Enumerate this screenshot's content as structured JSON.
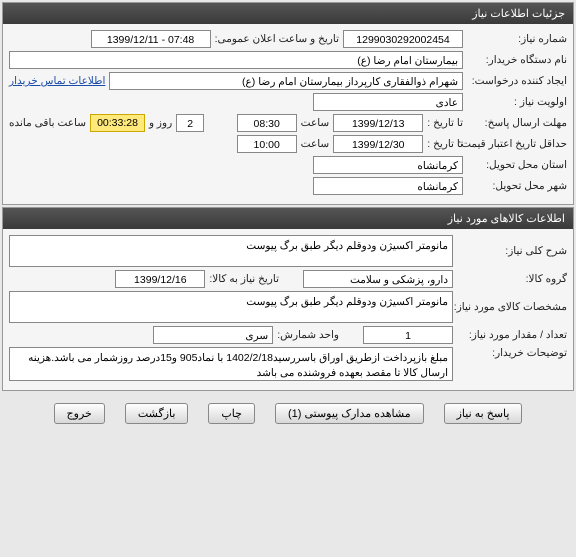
{
  "panel1": {
    "title": "جزئیات اطلاعات نیاز",
    "need_no_label": "شماره نیاز:",
    "need_no": "1299030292002454",
    "pub_datetime_label": "تاریخ و ساعت اعلان عمومی:",
    "pub_datetime": "1399/12/11 - 07:48",
    "buyer_org_label": "نام دستگاه خریدار:",
    "buyer_org": "بیمارستان امام رضا (ع)",
    "requester_label": "ایجاد کننده درخواست:",
    "requester": "شهرام ذوالفقاری کارپرداز بیمارستان امام رضا (ع)",
    "contact_link": "اطلاعات تماس خریدار",
    "priority_label": "اولویت نیاز :",
    "priority": "عادی",
    "reply_deadline_label": "مهلت ارسال پاسخ:",
    "to_date_label": "تا تاریخ :",
    "reply_date": "1399/12/13",
    "time_label": "ساعت",
    "reply_time": "08:30",
    "days_label": "روز و",
    "days": "2",
    "countdown": "00:33:28",
    "remain_label": "ساعت باقی مانده",
    "min_validity_label": "حداقل تاریخ اعتبار قیمت:",
    "to_date_label2": "تا تاریخ :",
    "validity_date": "1399/12/30",
    "validity_time": "10:00",
    "delivery_prov_label": "استان محل تحویل:",
    "delivery_prov": "کرمانشاه",
    "delivery_city_label": "شهر محل تحویل:",
    "delivery_city": "کرمانشاه"
  },
  "panel2": {
    "title": "اطلاعات کالاهای مورد نیاز",
    "desc_label": "شرح کلی نیاز:",
    "desc": "مانومتر اکسیژن  ودوقلم دیگر طبق برگ پیوست",
    "group_label": "گروه کالا:",
    "group": "دارو، پزشکی و سلامت",
    "need_date_label": "تاریخ نیاز به کالا:",
    "need_date": "1399/12/16",
    "spec_label": "مشخصات کالای مورد نیاز:",
    "spec": "مانومتر اکسیژن  ودوقلم دیگر طبق برگ پیوست",
    "qty_label": "تعداد / مقدار مورد نیاز:",
    "qty": "1",
    "unit_label": "واحد شمارش:",
    "unit": "سری",
    "buyer_note_label": "توضیحات خریدار:",
    "buyer_note": "مبلغ بازپرداخت ازطریق اوراق باسررسید1402/2/18 با نماد905 و15درصد روزشمار می باشد.هزینه ارسال کالا تا مقصد بعهده فروشنده می باشد"
  },
  "buttons": {
    "reply": "پاسخ به نیاز",
    "attach": "مشاهده مدارک پیوستی (1)",
    "print": "چاپ",
    "back": "بازگشت",
    "exit": "خروج"
  }
}
